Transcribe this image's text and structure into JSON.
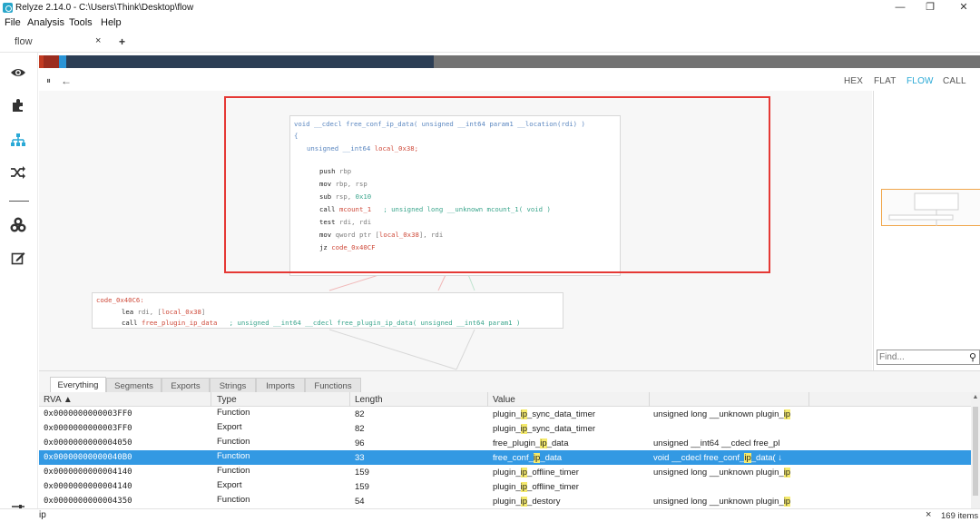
{
  "window": {
    "title": "Relyze 2.14.0 - C:\\Users\\Think\\Desktop\\flow",
    "minimize": "—",
    "maximize": "❐",
    "close": "✕"
  },
  "menu": {
    "file": "File",
    "analysis": "Analysis",
    "tools": "Tools",
    "help": "Help"
  },
  "doc_tab": {
    "label": "flow",
    "close": "×",
    "new_tab": "+"
  },
  "overview": {
    "colors": {
      "red": "#c23b22",
      "dark_red": "#9b2d1f",
      "blue": "#2a94d6",
      "navy": "#2c3e55",
      "gray": "#737373"
    }
  },
  "view_header": {
    "pin": "⏸",
    "back": "←",
    "modes": [
      "HEX",
      "FLAT",
      "FLOW",
      "CALL"
    ],
    "active_mode": "FLOW"
  },
  "code": {
    "main_signature": {
      "ret": "void",
      "conv": "__cdecl",
      "name": "free_conf_ip_data",
      "open": "(",
      "param_type": "unsigned __int64",
      "param_name": "param1",
      "location": "__location(rdi)",
      "close": ")"
    },
    "brace": "{",
    "local_decl": {
      "type": "unsigned __int64",
      "name": "local_0x38;"
    },
    "instr": {
      "push_op": "push",
      "push_arg": "rbp",
      "mov1_op": "mov",
      "mov1_arg": "rbp, rsp",
      "sub_op": "sub",
      "sub_arg": "rsp, ",
      "sub_imm": "0x10",
      "call1_op": "call",
      "call1_target": "mcount_1",
      "call1_comment": "; unsigned long __unknown mcount_1( void )",
      "test_op": "test",
      "test_arg": "rdi, rdi",
      "mov2_op": "mov",
      "mov2_pre": "qword ptr [",
      "mov2_mem": "local_0x38",
      "mov2_post": "], rdi",
      "jz_op": "jz",
      "jz_target": "code_0x40CF"
    },
    "second_block": {
      "label": "code_0x40C6:",
      "lea_op": "lea",
      "lea_pre": "rdi, [",
      "lea_mem": "local_0x38",
      "lea_post": "]",
      "call_op": "call",
      "call_target": "free_plugin_ip_data",
      "call_comment": "; unsigned __int64 __cdecl free_plugin_ip_data( unsigned __int64 param1 )"
    }
  },
  "find": {
    "placeholder": "Find...",
    "icon": "⚲"
  },
  "bottom_tabs": [
    "Everything",
    "Segments",
    "Exports",
    "Strings",
    "Imports",
    "Functions"
  ],
  "table": {
    "columns": [
      "RVA ▲",
      "Type",
      "Length",
      "Value"
    ],
    "rows": [
      {
        "rva": "0x0000000000003FF0",
        "type": "Function",
        "length": "82",
        "value_pre": "plugin_",
        "value_hl": "ip",
        "value_post": "_sync_data_timer",
        "extra_pre": "unsigned long __unknown plugin_",
        "extra_hl": "ip"
      },
      {
        "rva": "0x0000000000003FF0",
        "type": "Export",
        "length": "82",
        "value_pre": "plugin_",
        "value_hl": "ip",
        "value_post": "_sync_data_timer",
        "extra_pre": "",
        "extra_hl": ""
      },
      {
        "rva": "0x0000000000004050",
        "type": "Function",
        "length": "96",
        "value_pre": "free_plugin_",
        "value_hl": "ip",
        "value_post": "_data",
        "extra_pre": "unsigned __int64 __cdecl free_pl",
        "extra_hl": ""
      },
      {
        "rva": "0x00000000000040B0",
        "type": "Function",
        "length": "33",
        "value_pre": "free_conf_",
        "value_hl": "ip",
        "value_post": "_data",
        "extra_pre": "void __cdecl free_conf_",
        "extra_hl": "ip",
        "extra_post": "_data( ↓"
      },
      {
        "rva": "0x0000000000004140",
        "type": "Function",
        "length": "159",
        "value_pre": "plugin_",
        "value_hl": "ip",
        "value_post": "_offline_timer",
        "extra_pre": "unsigned long __unknown plugin_",
        "extra_hl": "ip"
      },
      {
        "rva": "0x0000000000004140",
        "type": "Export",
        "length": "159",
        "value_pre": "plugin_",
        "value_hl": "ip",
        "value_post": "_offline_timer",
        "extra_pre": "",
        "extra_hl": ""
      },
      {
        "rva": "0x0000000000004350",
        "type": "Function",
        "length": "54",
        "value_pre": "plugin_",
        "value_hl": "ip",
        "value_post": "_destory",
        "extra_pre": "unsigned long __unknown plugin_",
        "extra_hl": "ip"
      }
    ],
    "selected_index": 3
  },
  "status": {
    "filter": "ip",
    "close": "×",
    "count": "169 items"
  }
}
